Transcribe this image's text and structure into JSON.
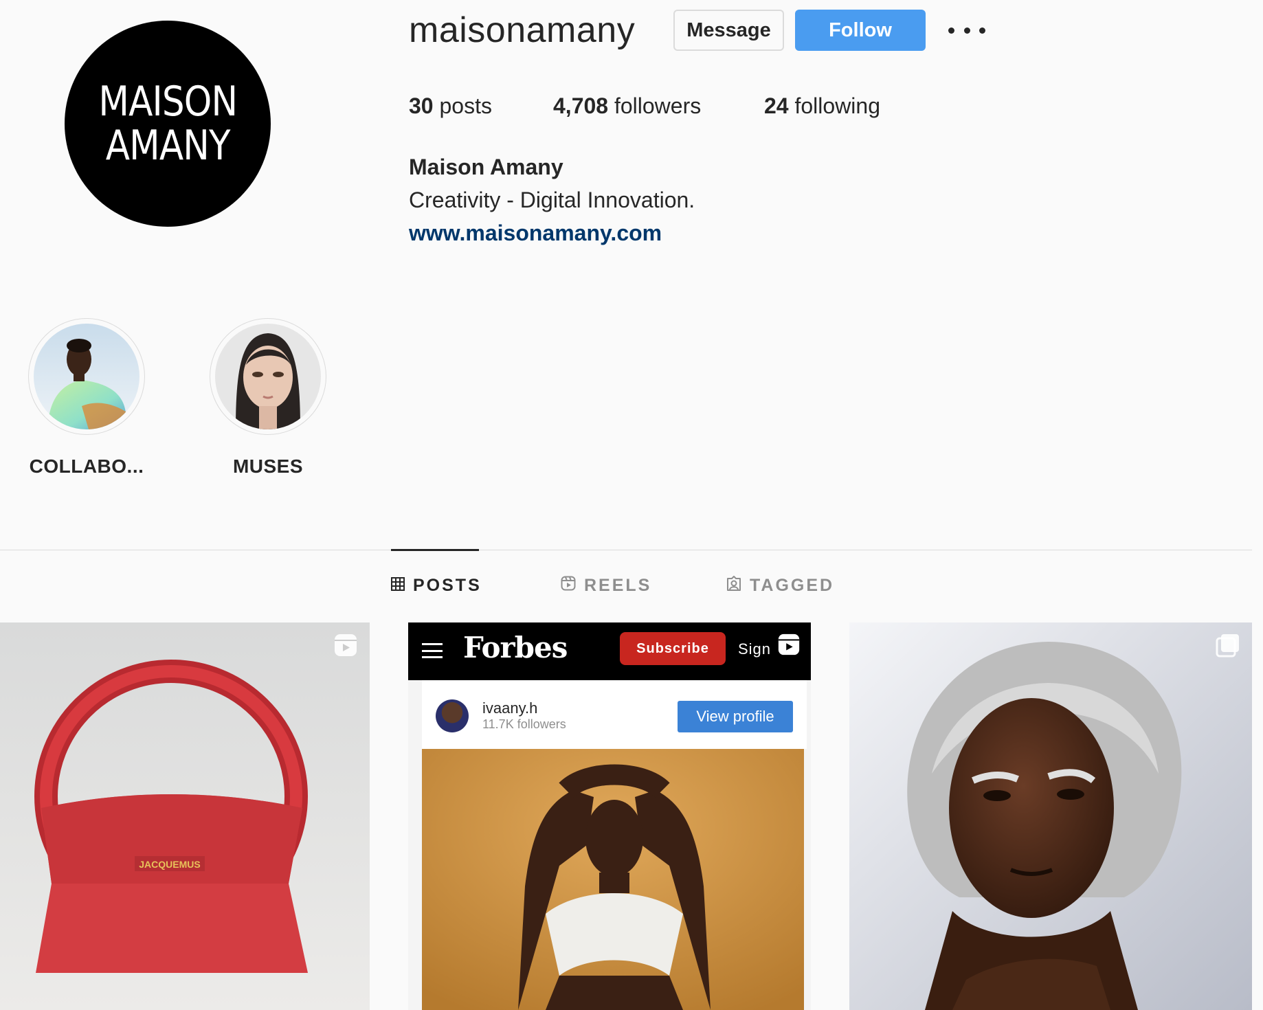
{
  "profile": {
    "avatar_line1": "MAISON",
    "avatar_line2": "AMANY",
    "username": "maisonamany",
    "message_label": "Message",
    "follow_label": "Follow",
    "stats": {
      "posts_count": "30",
      "posts_label": " posts",
      "followers_count": "4,708",
      "followers_label": " followers",
      "following_count": "24",
      "following_label": " following"
    },
    "full_name": "Maison Amany",
    "bio": "Creativity - Digital Innovation.",
    "website": "www.maisonamany.com"
  },
  "highlights": [
    {
      "label": "COLLABO..."
    },
    {
      "label": "MUSES"
    }
  ],
  "tabs": [
    {
      "label": "POSTS",
      "icon": "grid-icon",
      "active": true
    },
    {
      "label": "REELS",
      "icon": "reels-icon",
      "active": false
    },
    {
      "label": "TAGGED",
      "icon": "tagged-icon",
      "active": false
    }
  ],
  "posts": [
    {
      "type": "reel",
      "bag_text": "JACQUEMUS"
    },
    {
      "type": "reel",
      "forbes": {
        "logo": "Forbes",
        "subscribe": "Subscribe",
        "sign": "Sign",
        "handle": "ivaany.h",
        "followers": "11.7K followers",
        "view_profile": "View profile"
      }
    },
    {
      "type": "carousel"
    }
  ],
  "colors": {
    "follow_button": "#4a9cf0",
    "website_link": "#00376b",
    "background": "#fafafa"
  }
}
